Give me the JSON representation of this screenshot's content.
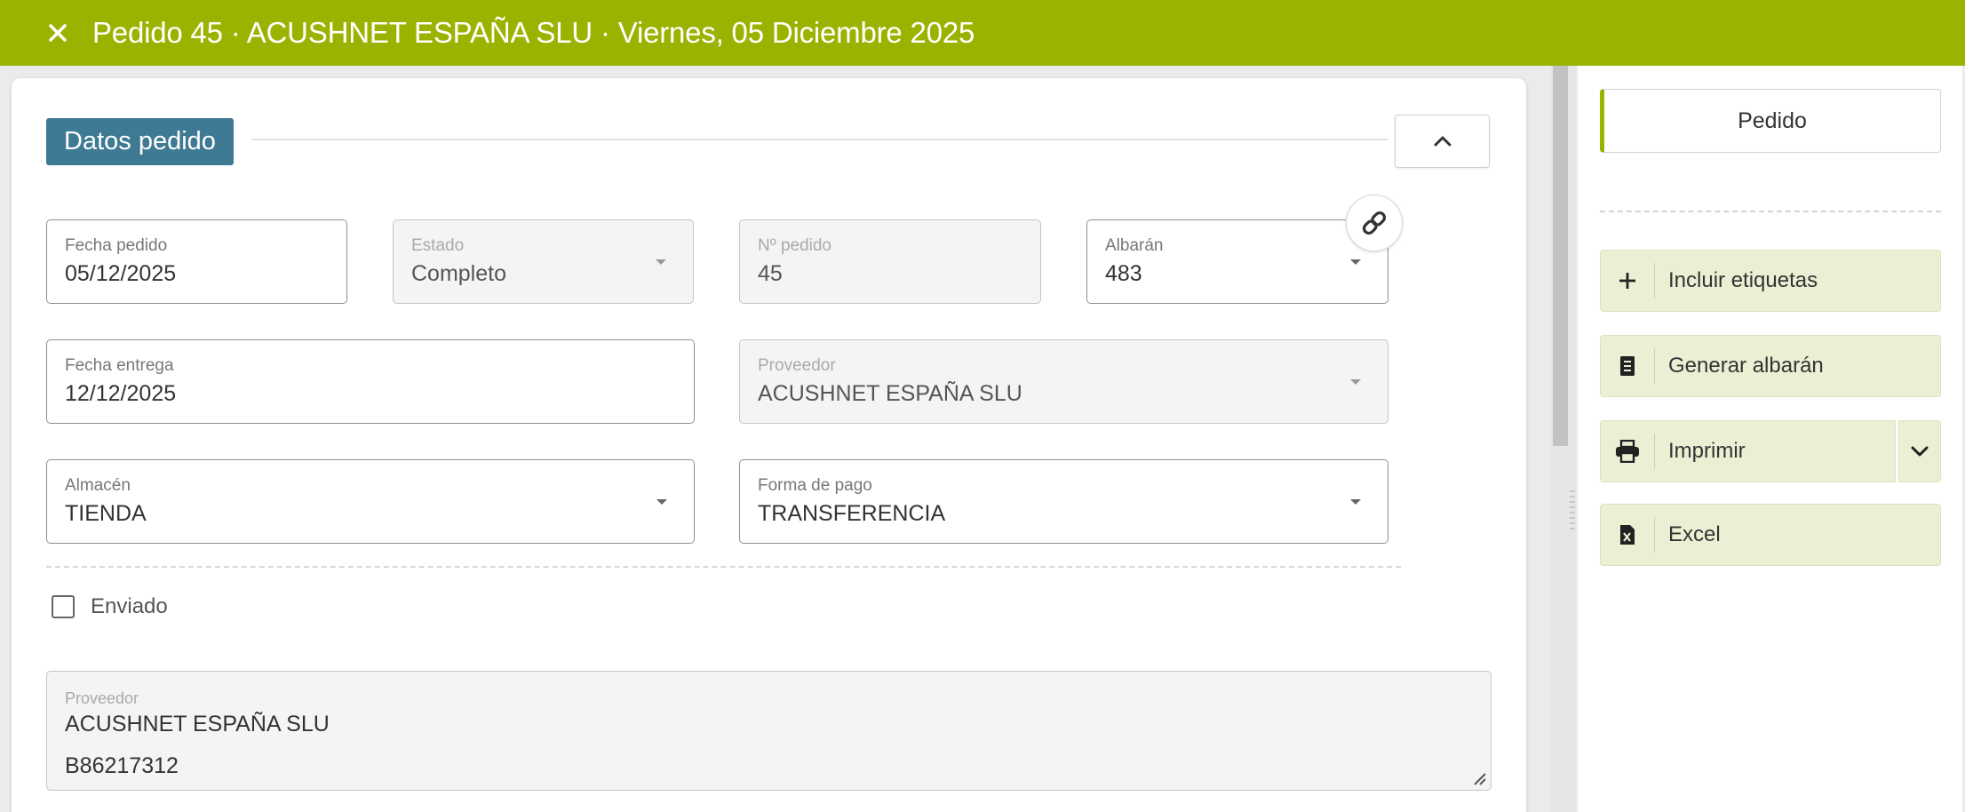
{
  "header": {
    "title": "Pedido 45 · ACUSHNET ESPAÑA SLU · Viernes, 05 Diciembre 2025",
    "close_icon": "close-icon",
    "background_color": "#9bb300"
  },
  "section": {
    "badge": "Datos pedido",
    "badge_color": "#3e7a93",
    "collapse_icon": "chevron-up-icon"
  },
  "fields": {
    "fecha_pedido": {
      "label": "Fecha pedido",
      "value": "05/12/2025"
    },
    "estado": {
      "label": "Estado",
      "value": "Completo"
    },
    "n_pedido": {
      "label": "Nº pedido",
      "value": "45"
    },
    "albaran": {
      "label": "Albarán",
      "value": "483"
    },
    "fecha_entrega": {
      "label": "Fecha entrega",
      "value": "12/12/2025"
    },
    "proveedor": {
      "label": "Proveedor",
      "value": "ACUSHNET ESPAÑA SLU"
    },
    "almacen": {
      "label": "Almacén",
      "value": "TIENDA"
    },
    "forma_pago": {
      "label": "Forma de pago",
      "value": "TRANSFERENCIA"
    }
  },
  "enviado": {
    "label": "Enviado",
    "checked": false
  },
  "proveedor_info": {
    "label": "Proveedor",
    "line1": "ACUSHNET ESPAÑA SLU",
    "line2": "B86217312"
  },
  "side": {
    "tab": "Pedido",
    "actions": {
      "incluir_etiquetas": {
        "label": "Incluir etiquetas",
        "icon": "plus-icon"
      },
      "generar_albaran": {
        "label": "Generar albarán",
        "icon": "document-icon"
      },
      "imprimir": {
        "label": "Imprimir",
        "icon": "printer-icon"
      },
      "excel": {
        "label": "Excel",
        "icon": "excel-file-icon"
      }
    },
    "action_bg": "#eaf0d3"
  }
}
